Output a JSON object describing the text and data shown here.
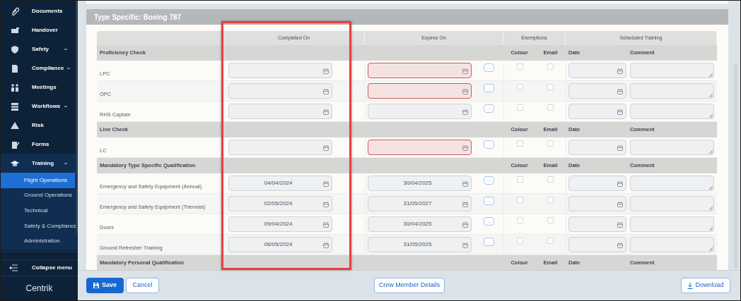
{
  "sidebar": {
    "items": [
      {
        "label": "Documents",
        "expandable": false,
        "expanded": false
      },
      {
        "label": "Handover",
        "expandable": false,
        "expanded": false
      },
      {
        "label": "Safety",
        "expandable": true,
        "expanded": false
      },
      {
        "label": "Compliance",
        "expandable": true,
        "expanded": false
      },
      {
        "label": "Meetings",
        "expandable": false,
        "expanded": false
      },
      {
        "label": "Workflows",
        "expandable": true,
        "expanded": false
      },
      {
        "label": "Risk",
        "expandable": false,
        "expanded": false
      },
      {
        "label": "Forms",
        "expandable": false,
        "expanded": false
      },
      {
        "label": "Training",
        "expandable": true,
        "expanded": true,
        "children": [
          {
            "label": "Flight Operations",
            "selected": true
          },
          {
            "label": "Ground Operations",
            "selected": false
          },
          {
            "label": "Technical",
            "selected": false
          },
          {
            "label": "Safety & Compliance",
            "selected": false
          },
          {
            "label": "Administration",
            "selected": false
          }
        ]
      }
    ],
    "collapse_label": "Collapse menu",
    "logo": "Centrik"
  },
  "section": {
    "title": "Type Specific: Boeing 787"
  },
  "table": {
    "columns": [
      "Completed On",
      "Expires On",
      "Exemptions",
      "Scheduled Training"
    ],
    "rows": [
      {
        "kind": "group",
        "label": "Proficiency Check",
        "subheaders": [
          "Colour",
          "Email",
          "Date",
          "Comment"
        ]
      },
      {
        "kind": "item",
        "label": "LPC",
        "completed": "",
        "expires": "",
        "expired": true,
        "colour_checked": false,
        "email_checked": false
      },
      {
        "kind": "item",
        "label": "OPC",
        "completed": "",
        "expires": "",
        "expired": true,
        "colour_checked": false,
        "email_checked": false
      },
      {
        "kind": "item",
        "label": "RHS Captain",
        "completed": "",
        "expires": "",
        "expired": false,
        "colour_checked": false,
        "email_checked": false
      },
      {
        "kind": "group",
        "label": "Line Check",
        "subheaders": [
          "Colour",
          "Email",
          "Date",
          "Comment"
        ]
      },
      {
        "kind": "item",
        "label": "LC",
        "completed": "",
        "expires": "",
        "expired": true,
        "colour_checked": false,
        "email_checked": false
      },
      {
        "kind": "group",
        "label": "Mandatory Type Specific Qualification",
        "subheaders": [
          "Colour",
          "Email",
          "Date",
          "Comment"
        ]
      },
      {
        "kind": "item",
        "label": "Emergency and Safety Equipment (Annual)",
        "completed": "04/04/2024",
        "expires": "30/04/2025",
        "expired": false,
        "colour_checked": false,
        "email_checked": false
      },
      {
        "kind": "item",
        "label": "Emergency and Safety Equipment (Triennial)",
        "completed": "02/05/2024",
        "expires": "31/05/2027",
        "expired": false,
        "colour_checked": false,
        "email_checked": false
      },
      {
        "kind": "item",
        "label": "Doors",
        "completed": "09/04/2024",
        "expires": "30/04/2025",
        "expired": false,
        "colour_checked": false,
        "email_checked": false
      },
      {
        "kind": "item",
        "label": "Ground Refresher Training",
        "completed": "06/05/2024",
        "expires": "31/05/2025",
        "expired": false,
        "colour_checked": false,
        "email_checked": false
      },
      {
        "kind": "group",
        "label": "Mandatory Personal Qualification",
        "subheaders": [
          "Colour",
          "Email",
          "Date",
          "Comment"
        ]
      }
    ]
  },
  "footer": {
    "save": "Save",
    "cancel": "Cancel",
    "details": "Crew Member Details",
    "download": "Download"
  },
  "more_button": "..."
}
